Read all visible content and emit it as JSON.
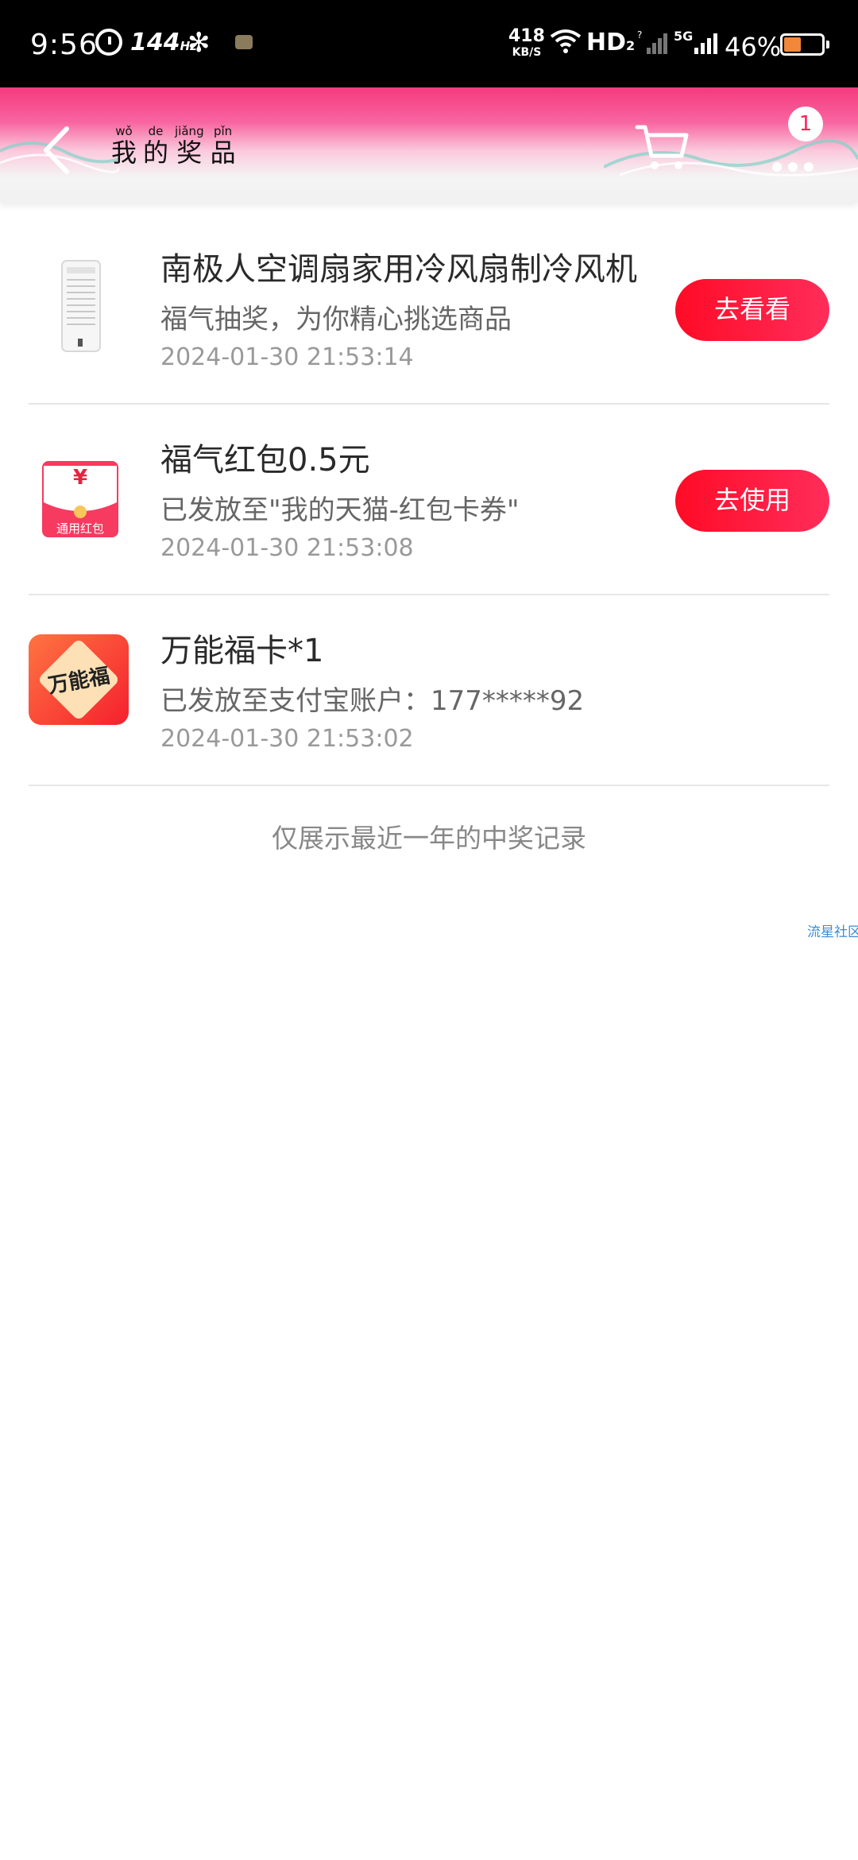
{
  "status_bar": {
    "time": "9:56",
    "refresh_rate": "144",
    "refresh_unit": "Hz",
    "net_speed": "418",
    "net_unit": "KB/S",
    "hd": "HD",
    "hd_sub": "2",
    "net_type": "5G",
    "battery_percent": "46%",
    "battery_level": 0.46
  },
  "header": {
    "back_icon": "chevron-left-icon",
    "title_chars": [
      "我",
      "的",
      "奖",
      "品"
    ],
    "title_pinyin": [
      "wǒ",
      "de",
      "jiǎng",
      "pǐn"
    ],
    "cart_icon": "cart-icon",
    "more_icon": "more-icon",
    "badge_count": "1"
  },
  "prizes": [
    {
      "title": "南极人空调扇家用冷风扇制冷风机",
      "desc": "福气抽奖，为你精心挑选商品",
      "time": "2024-01-30 21:53:14",
      "action": "去看看",
      "thumb": "air-cooler-image"
    },
    {
      "title": "福气红包0.5元",
      "desc": "已发放至\"我的天猫-红包卡券\"",
      "time": "2024-01-30 21:53:08",
      "action": "去使用",
      "thumb": "red-envelope-image",
      "thumb_symbol": "¥",
      "thumb_label": "通用红包"
    },
    {
      "title": "万能福卡*1",
      "desc": "已发放至支付宝账户：177*****92",
      "time": "2024-01-30 21:53:02",
      "thumb": "fu-card-image",
      "thumb_text": "万能福"
    }
  ],
  "footer_note": "仅展示最近一年的中奖记录",
  "watermark": "流星社区",
  "colors": {
    "accent": "#ff1f4b",
    "header_pink": "#f43a7e"
  }
}
